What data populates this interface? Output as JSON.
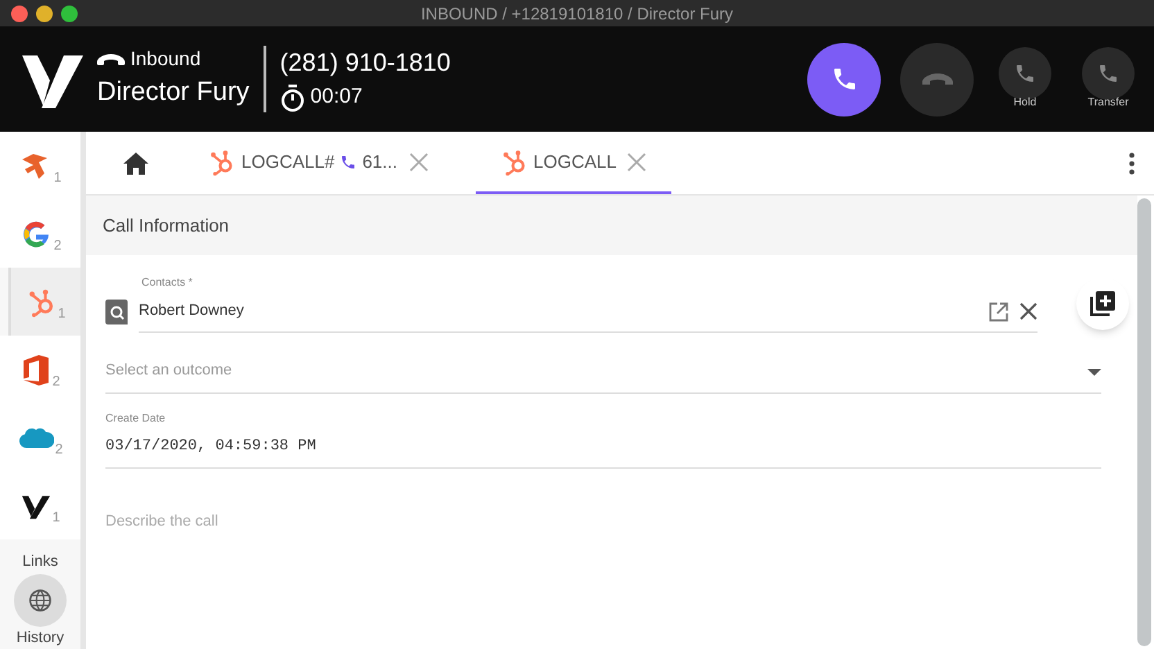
{
  "window": {
    "title": "INBOUND / +12819101810 / Director Fury"
  },
  "call": {
    "direction": "Inbound",
    "name": "Director Fury",
    "number": "(281) 910-1810",
    "timer": "00:07"
  },
  "call_buttons": [
    {
      "kind": "answer"
    },
    {
      "kind": "hangup"
    },
    {
      "kind": "hold",
      "label": "Hold"
    },
    {
      "kind": "transfer",
      "label": "Transfer"
    }
  ],
  "sidebar": {
    "items": [
      {
        "kind": "hero",
        "count": "1",
        "selected": false
      },
      {
        "kind": "google",
        "count": "2",
        "selected": false
      },
      {
        "kind": "hubspot",
        "count": "1",
        "selected": true
      },
      {
        "kind": "office",
        "count": "2",
        "selected": false
      },
      {
        "kind": "salesforce",
        "count": "2",
        "selected": false
      },
      {
        "kind": "vonage",
        "count": "1",
        "selected": false
      }
    ],
    "links_label": "Links",
    "history_label": "History"
  },
  "tabs": [
    {
      "kind": "home",
      "selected": false
    },
    {
      "kind": "hubspot",
      "label": "LOGCALL#",
      "suffix": "61...",
      "selected": false
    },
    {
      "kind": "hubspot",
      "label": "LOGCALL",
      "selected": true
    }
  ],
  "section_title": "Call Information",
  "form": {
    "contacts_label": "Contacts *",
    "contact": "Robert Downey",
    "outcome_placeholder": "Select an outcome",
    "date_label": "Create Date",
    "date": "03/17/2020, 04:59:38 PM",
    "description_placeholder": "Describe the call"
  }
}
